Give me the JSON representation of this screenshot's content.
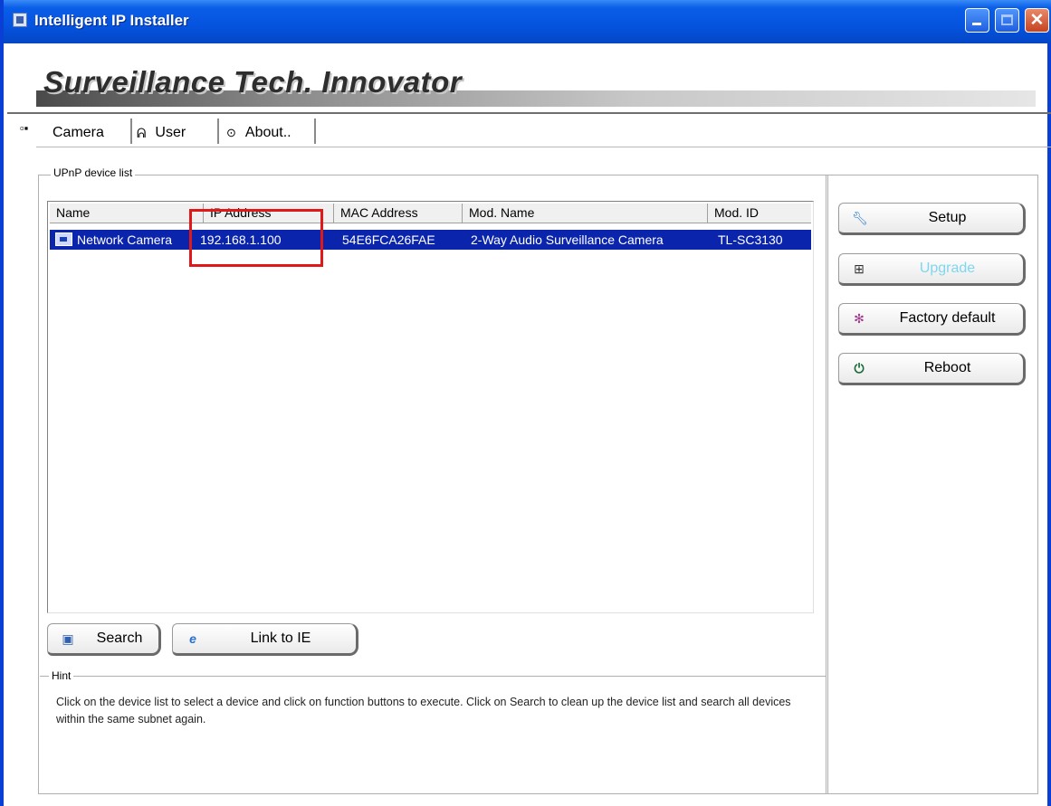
{
  "window": {
    "title": "Intelligent IP Installer",
    "minimize_symbol": "_",
    "maximize_symbol": "□",
    "close_symbol": "X"
  },
  "branding": {
    "slogan": "Surveillance Tech. Innovator"
  },
  "tabs": [
    {
      "label": "Camera",
      "icon": "camera-icon",
      "active": true
    },
    {
      "label": "User",
      "icon": "user-icon",
      "active": false
    },
    {
      "label": "About..",
      "icon": "info-icon",
      "active": false
    }
  ],
  "device_list": {
    "group_title": "UPnP device list",
    "columns": [
      "Name",
      "IP Address",
      "MAC Address",
      "Mod. Name",
      "Mod. ID"
    ],
    "rows": [
      {
        "name": "Network Camera",
        "ip": "192.168.1.100",
        "mac": "54E6FCA26FAE",
        "model_name": "2-Way Audio Surveillance Camera",
        "model_id": "TL-SC3130",
        "selected": true
      }
    ]
  },
  "list_buttons": {
    "search": "Search",
    "link_ie": "Link to IE"
  },
  "function_buttons": {
    "setup": "Setup",
    "upgrade": "Upgrade",
    "factory_default": "Factory default",
    "reboot": "Reboot"
  },
  "hint": {
    "title": "Hint",
    "text": "Click on the device list to select a device and click on function buttons to execute. Click on Search to clean up the device list and search all devices  within the same subnet again."
  },
  "colors": {
    "titlebar": "#0553de",
    "selection": "#0a24ac",
    "highlight_box": "#e01818",
    "disabled_text": "#7fd6f0"
  }
}
